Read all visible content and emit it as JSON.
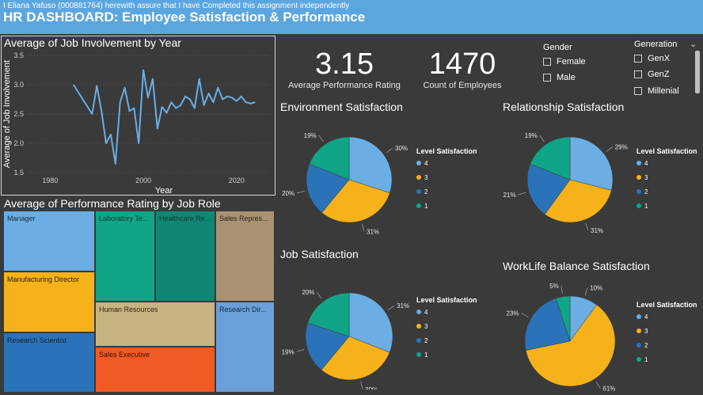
{
  "header": {
    "subtitle": "I Eliana Yafuso (000881764) herewith assure that I have Completed this assignment independently",
    "title": "HR DASHBOARD: Employee Satisfaction & Performance"
  },
  "colors": {
    "header_bg": "#5ca6e0",
    "background": "#3a3a3a",
    "level4": "#6aaee4",
    "level3": "#f5b21a",
    "level2": "#2b73b9",
    "level1": "#10a587",
    "line": "#6aaee4"
  },
  "kpis": [
    {
      "value": "3.15",
      "label": "Average Performance Rating"
    },
    {
      "value": "1470",
      "label": "Count of Employees"
    }
  ],
  "gender_slicer": {
    "title": "Gender",
    "options": [
      "Female",
      "Male"
    ]
  },
  "generation_slicer": {
    "title": "Generation",
    "options": [
      "GenX",
      "GenZ",
      "Millenial"
    ],
    "icon": "chevron-down-icon"
  },
  "line_chart": {
    "title": "Average of Job Involvement by Year",
    "xlabel": "Year",
    "ylabel": "Average of Job Involvement"
  },
  "treemap": {
    "title": "Average of Performance Rating by Job Role",
    "labels": {
      "manager": "Manager",
      "manufacturing_director": "Manufacturing Director",
      "research_scientist": "Research Scientist",
      "laboratory_technician": "Laboratory Te...",
      "healthcare_representative": "Healthcare Re...",
      "sales_representative": "Sales Repres...",
      "human_resources": "Human Resources",
      "sales_executive": "Sales Executive",
      "research_director": "Research Dir..."
    }
  },
  "legend": {
    "title": "Level Satisfaction",
    "levels": [
      "4",
      "3",
      "2",
      "1"
    ]
  },
  "chart_data": [
    {
      "type": "line",
      "title": "Average of Job Involvement by Year",
      "xlabel": "Year",
      "ylabel": "Average of Job Involvement",
      "xlim": [
        1975,
        2027
      ],
      "ylim": [
        1.5,
        3.5
      ],
      "xticks": [
        "1980",
        "2000",
        "2020"
      ],
      "yticks": [
        "1.5",
        "2.0",
        "2.5",
        "3.0",
        "3.5"
      ],
      "x": [
        1985,
        1987,
        1989,
        1990,
        1991,
        1992,
        1993,
        1994,
        1995,
        1996,
        1997,
        1998,
        1999,
        2000,
        2001,
        2002,
        2003,
        2004,
        2005,
        2006,
        2007,
        2008,
        2009,
        2010,
        2011,
        2012,
        2013,
        2014,
        2015,
        2016,
        2017,
        2018,
        2019,
        2020,
        2021,
        2022,
        2023,
        2024
      ],
      "y": [
        3.0,
        2.75,
        2.5,
        2.98,
        2.55,
        2.0,
        2.15,
        1.65,
        2.7,
        2.95,
        2.55,
        2.6,
        2.0,
        3.25,
        2.78,
        3.1,
        2.25,
        2.62,
        2.52,
        2.7,
        2.6,
        2.65,
        2.8,
        2.75,
        2.6,
        3.1,
        2.65,
        2.85,
        2.7,
        2.95,
        2.75,
        2.8,
        2.78,
        2.72,
        2.8,
        2.7,
        2.68,
        2.7
      ],
      "series": [
        {
          "name": ""
        }
      ]
    },
    {
      "type": "pie",
      "title": "Environment Satisfaction",
      "legend_title": "Level Satisfaction",
      "categories": [
        "4",
        "3",
        "2",
        "1"
      ],
      "values": [
        30,
        31,
        20,
        19
      ],
      "labels": [
        "30%",
        "31%",
        "20%",
        "19%"
      ]
    },
    {
      "type": "pie",
      "title": "Relationship Satisfaction",
      "legend_title": "Level Satisfaction",
      "categories": [
        "4",
        "3",
        "2",
        "1"
      ],
      "values": [
        29,
        31,
        21,
        19
      ],
      "labels": [
        "29%",
        "31%",
        "21%",
        "19%"
      ]
    },
    {
      "type": "pie",
      "title": "Job Satisfaction",
      "legend_title": "Level Satisfaction",
      "categories": [
        "4",
        "3",
        "2",
        "1"
      ],
      "values": [
        31,
        30,
        19,
        20
      ],
      "labels": [
        "31%",
        "30%",
        "19%",
        "20%"
      ]
    },
    {
      "type": "pie",
      "title": "WorkLife Balance Satisfaction",
      "legend_title": "Level Satisfaction",
      "categories": [
        "4",
        "3",
        "2",
        "1"
      ],
      "values": [
        10,
        61,
        23,
        5
      ],
      "labels": [
        "10%",
        "61%",
        "23%",
        "5%"
      ]
    }
  ]
}
